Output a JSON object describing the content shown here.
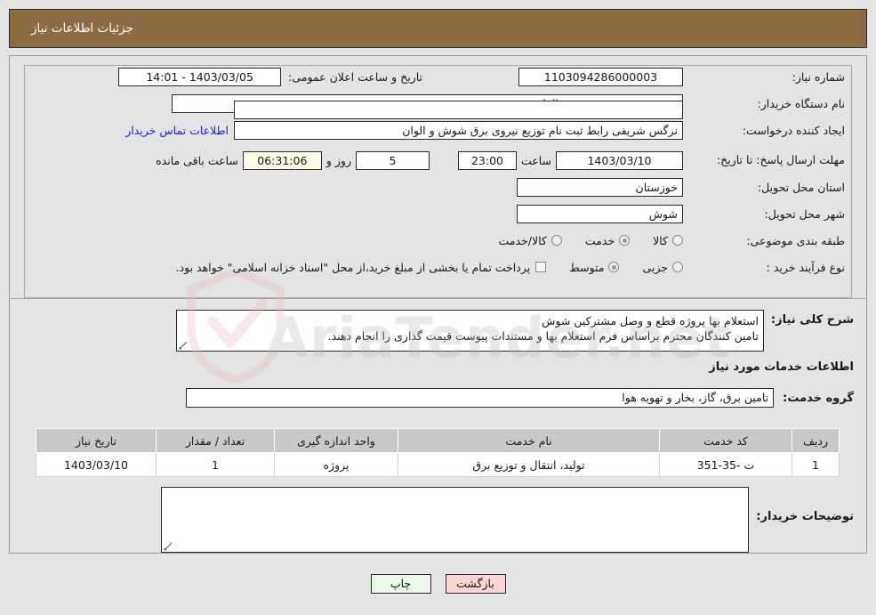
{
  "header": {
    "title": "جزئیات اطلاعات نیاز"
  },
  "form": {
    "need_number_label": "شماره نیاز:",
    "need_number_value": "1103094286000003",
    "public_announce_label": "تاریخ و ساعت اعلان عمومی:",
    "public_announce_value": "1403/03/05 - 14:01",
    "buyer_org_label": "نام دستگاه خریدار:",
    "buyer_org_value": "توزیع نیروی برق شوش و الوان",
    "empty_field_value": "",
    "requester_label": "ایجاد کننده درخواست:",
    "requester_value": "نرگس شریفی رابط ثبت نام توزیع نیروی برق شوش و الوان",
    "contact_link": "اطلاعات تماس خریدار",
    "deadline_label": "مهلت ارسال پاسخ: تا تاریخ:",
    "deadline_date": "1403/03/10",
    "hour_label": "ساعت",
    "deadline_time": "23:00",
    "remaining_days": "5",
    "days_and_label": "روز و",
    "remaining_time": "06:31:06",
    "hours_remaining_label": "ساعت باقی مانده",
    "province_label": "استان محل تحویل:",
    "province_value": "خوزستان",
    "city_label": "شهر محل تحویل:",
    "city_value": "شوش",
    "category_label": "طبقه بندی موضوعی:",
    "category_options": [
      {
        "label": "کالا",
        "selected": false
      },
      {
        "label": "خدمت",
        "selected": true
      },
      {
        "label": "کالا/خدمت",
        "selected": false
      }
    ],
    "process_label": "نوع فرآیند خرید :",
    "process_options": [
      {
        "label": "جزیی",
        "selected": false
      },
      {
        "label": "متوسط",
        "selected": true
      }
    ],
    "treasury_checkbox_checked": false,
    "treasury_note": "پرداخت تمام یا بخشی از مبلغ خرید،از محل \"اسناد خزانه اسلامی\" خواهد بود."
  },
  "description": {
    "label": "شرح کلی نیاز:",
    "value": "استعلام بها پروژه قطع و وصل مشترکین شوش\nتامین کنندگان محترم براساس فرم استعلام بها و مستندات پیوست قیمت گذاری را انجام دهند."
  },
  "services_section": {
    "title": "اطلاعات خدمات مورد نیاز",
    "group_label": "گروه خدمت:",
    "group_value": "تامین برق، گاز، بخار و تهویه هوا"
  },
  "table": {
    "headers": [
      "ردیف",
      "کد خدمت",
      "نام خدمت",
      "واحد اندازه گیری",
      "تعداد / مقدار",
      "تاریخ نیاز"
    ],
    "rows": [
      {
        "row_no": "1",
        "service_code": "ت -35-351",
        "service_name": "تولید، انتقال و توزیع برق",
        "unit": "پروژه",
        "quantity": "1",
        "need_date": "1403/03/10"
      }
    ]
  },
  "buyer_notes": {
    "label": "توضیحات خریدار:",
    "value": ""
  },
  "footer": {
    "print_label": "چاپ",
    "back_label": "بازگشت"
  },
  "watermark": {
    "text": "AriaTender.net"
  },
  "colors": {
    "header_bg": "#8d6b43",
    "page_bg": "#e4e4e4",
    "link": "#2020e0",
    "table_header_bg": "#c9c9c9",
    "print_btn": "#eaf7ea",
    "back_btn": "#fbd5d5",
    "countdown_bg": "#fbfbe8"
  }
}
